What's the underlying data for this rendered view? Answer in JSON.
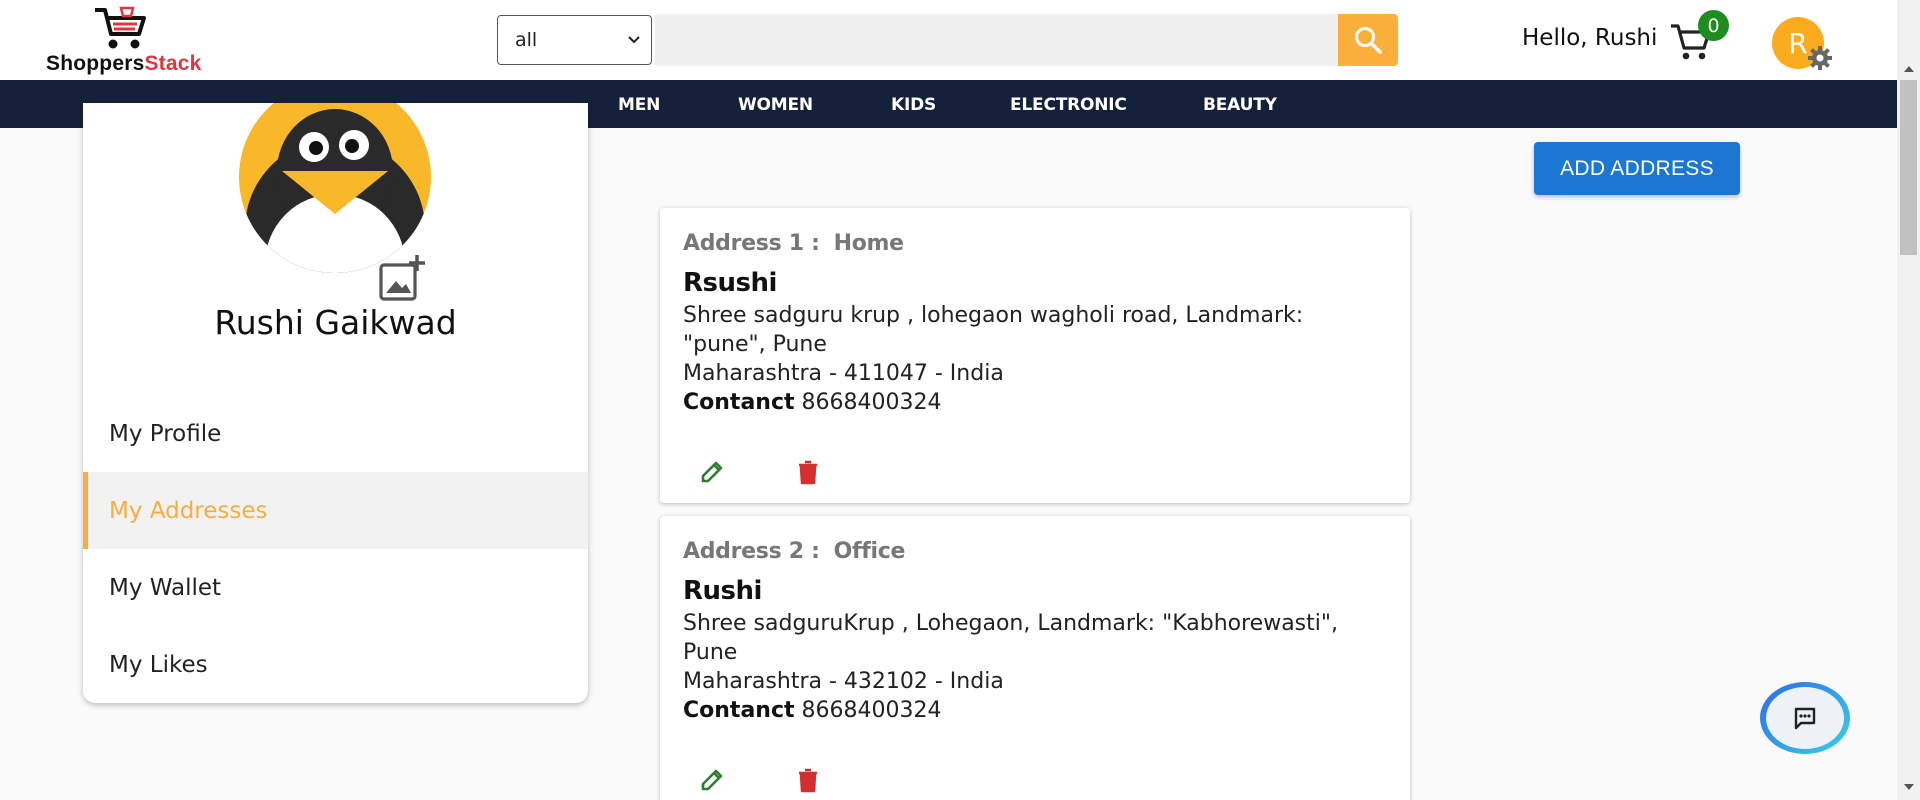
{
  "header": {
    "logo_text_main": "Shoppers",
    "logo_text_accent": "Stack",
    "category_selected": "all",
    "search_placeholder": "",
    "greeting": "Hello, Rushi",
    "cart_count": "0",
    "avatar_initial": "R"
  },
  "colors": {
    "accent": "#fbb03b",
    "nav_bg": "#15213b",
    "primary_button": "#1b77d2",
    "cart_badge": "#1e8c1e",
    "delete_icon": "#d32f2f",
    "edit_icon": "#2e7d32"
  },
  "nav": {
    "items": [
      "MEN",
      "WOMEN",
      "KIDS",
      "ELECTRONIC",
      "BEAUTY"
    ]
  },
  "profile": {
    "name": "Rushi Gaikwad",
    "menu": [
      {
        "label": "My Profile",
        "active": false
      },
      {
        "label": "My Addresses",
        "active": true
      },
      {
        "label": "My Wallet",
        "active": false
      },
      {
        "label": "My Likes",
        "active": false
      }
    ]
  },
  "main": {
    "add_address_label": "ADD ADDRESS",
    "addresses": [
      {
        "label": "Address 1 :",
        "type": "Home",
        "name": "Rsushi",
        "line1": "Shree sadguru krup , lohegaon wagholi road, Landmark:",
        "line2": "\"pune\", Pune",
        "line3": "Maharashtra - 411047 - India",
        "contact_label": "Contanct",
        "contact": "8668400324"
      },
      {
        "label": "Address 2 :",
        "type": "Office",
        "name": "Rushi",
        "line1": "Shree sadguruKrup , Lohegaon, Landmark: \"Kabhorewasti\",",
        "line2": "Pune",
        "line3": "Maharashtra - 432102 - India",
        "contact_label": "Contanct",
        "contact": "8668400324"
      }
    ]
  },
  "icons": {
    "search": "search-icon",
    "cart": "cart-icon",
    "settings": "gear-icon",
    "edit": "pencil-icon",
    "delete": "trash-icon",
    "add_photo": "add-photo-icon",
    "chat": "chat-icon"
  }
}
